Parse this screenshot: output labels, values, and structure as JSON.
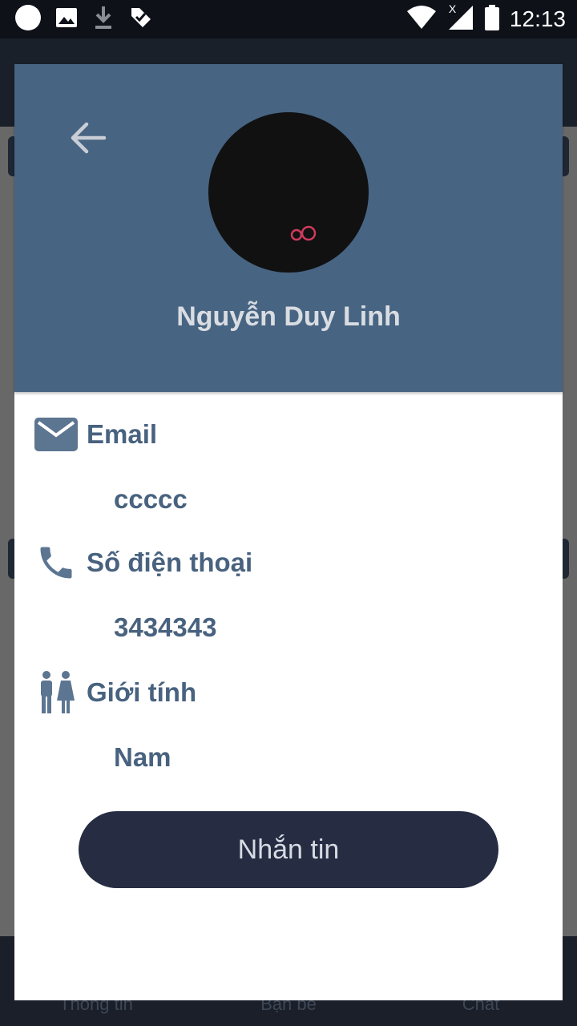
{
  "status_bar": {
    "time": "12:13",
    "network_mark": "X",
    "icons": [
      "circle-icon",
      "image-icon",
      "download-icon",
      "checklist-icon",
      "wifi-icon",
      "signal-icon",
      "battery-icon"
    ]
  },
  "background_nav": {
    "items": [
      {
        "label": "Thông tin"
      },
      {
        "label": "Bạn bè"
      },
      {
        "label": "Chat"
      }
    ]
  },
  "profile": {
    "name": "Nguyễn Duy Linh",
    "avatar_mark": "oO",
    "avatar_mark_color": "#d03a5c"
  },
  "info": {
    "email": {
      "label": "Email",
      "value": "ccccc"
    },
    "phone": {
      "label": "Số điện thoại",
      "value": "3434343"
    },
    "gender": {
      "label": "Giới tính",
      "value": "Nam"
    }
  },
  "actions": {
    "message_label": "Nhắn tin"
  },
  "colors": {
    "header_bg": "#476482",
    "accent_text": "#48627f",
    "button_bg": "#262d42"
  }
}
